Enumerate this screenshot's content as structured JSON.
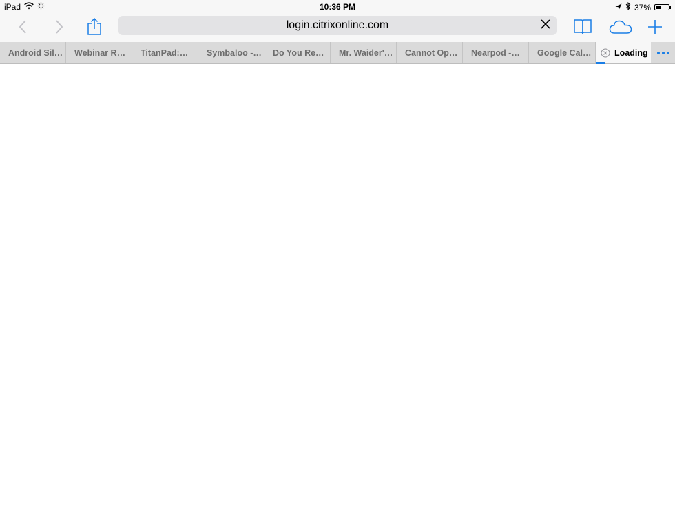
{
  "status_bar": {
    "device": "iPad",
    "time": "10:36 PM",
    "battery_text": "37%",
    "battery_level": 0.37,
    "icons": [
      "wifi-icon",
      "activity-spinner-icon",
      "location-arrow-icon",
      "bluetooth-icon",
      "battery-icon"
    ]
  },
  "toolbar": {
    "url": "login.citrixonline.com",
    "icons": [
      "back-icon",
      "forward-icon",
      "share-icon",
      "clear-url-icon",
      "bookmarks-icon",
      "icloud-tabs-icon",
      "new-tab-icon"
    ],
    "accent_color": "#1a7ee6"
  },
  "tabs": {
    "items": [
      {
        "label": "Android Sil…"
      },
      {
        "label": "Webinar R…"
      },
      {
        "label": "TitanPad:…"
      },
      {
        "label": "Symbaloo -…"
      },
      {
        "label": "Do You Re…"
      },
      {
        "label": "Mr. Waider'…"
      },
      {
        "label": "Cannot Op…"
      },
      {
        "label": "Nearpod -…"
      },
      {
        "label": "Google Cal…"
      }
    ],
    "active": {
      "label": "Loading",
      "progress": 0.17
    },
    "more_icon": "more-tabs-icon"
  }
}
